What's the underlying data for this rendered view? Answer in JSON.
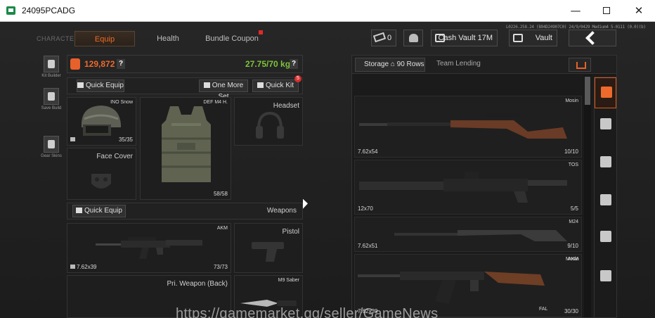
{
  "window": {
    "title": "24095PCADG",
    "minimize": "—",
    "close": "✕"
  },
  "info": "L0226.258.24 (B94D24907C0) 24/9/0429 Medium4 5-0111 (0.0)(b)",
  "nav": {
    "character": "CHARACTER",
    "equip": "Equip",
    "health": "Health",
    "bundle_coupon": "Bundle Coupon"
  },
  "topbar": {
    "ticket_count": "0",
    "cash_vault": "Cash Vault 17M",
    "vault": "Vault"
  },
  "side_tools": {
    "kit_builder": "Kit Builder",
    "save_build": "Save Build",
    "gear_skins": "Gear Skins"
  },
  "equip": {
    "money": "129,872",
    "weight": "27.75/70 kg",
    "help": "?",
    "quick_equip": "Quick Equip",
    "one_more_set": "One More Set",
    "quick_kit": "Quick Kit",
    "quick_kit_badge": "5",
    "weapons_label": "Weapons"
  },
  "slots": {
    "helmet": {
      "name": "INO Snow",
      "count": "35/35"
    },
    "vest": {
      "name": "DEF M4 H.",
      "count": "58/58"
    },
    "headset": {
      "name": "Headset"
    },
    "face_cover": {
      "name": "Face Cover"
    },
    "primary": {
      "name": "AKM",
      "caliber": "7.62x39",
      "count": "73/73"
    },
    "pistol": {
      "name": "Pistol"
    },
    "back": {
      "name": "Pri. Weapon (Back)"
    },
    "melee": {
      "name": "M9 Saber"
    }
  },
  "storage": {
    "tab_storage": "Storage",
    "rows": "90 Rows",
    "tab_team": "Team Lending",
    "items": [
      {
        "name": "Mosin",
        "caliber": "7.62x54",
        "count": "10/10"
      },
      {
        "name": "TOS",
        "caliber": "12x70",
        "count": "5/5"
      },
      {
        "name": "M24",
        "caliber": "7.62x51",
        "count": "9/10"
      },
      {
        "name": "AKM",
        "caliber": "7.62x39",
        "count": "30/30"
      }
    ],
    "extra_name": "Mosin",
    "extra_tag": "FAL"
  },
  "filters": [
    "storage-icon",
    "gear-icon",
    "assault-rifle-icon",
    "magazine-icon",
    "ammo-icon",
    "backpack-icon"
  ],
  "watermark": "https://gamemarket.gg/seller/GameNews",
  "colors": {
    "accent": "#ee6a2c",
    "weight_ok": "#7ec43a"
  }
}
